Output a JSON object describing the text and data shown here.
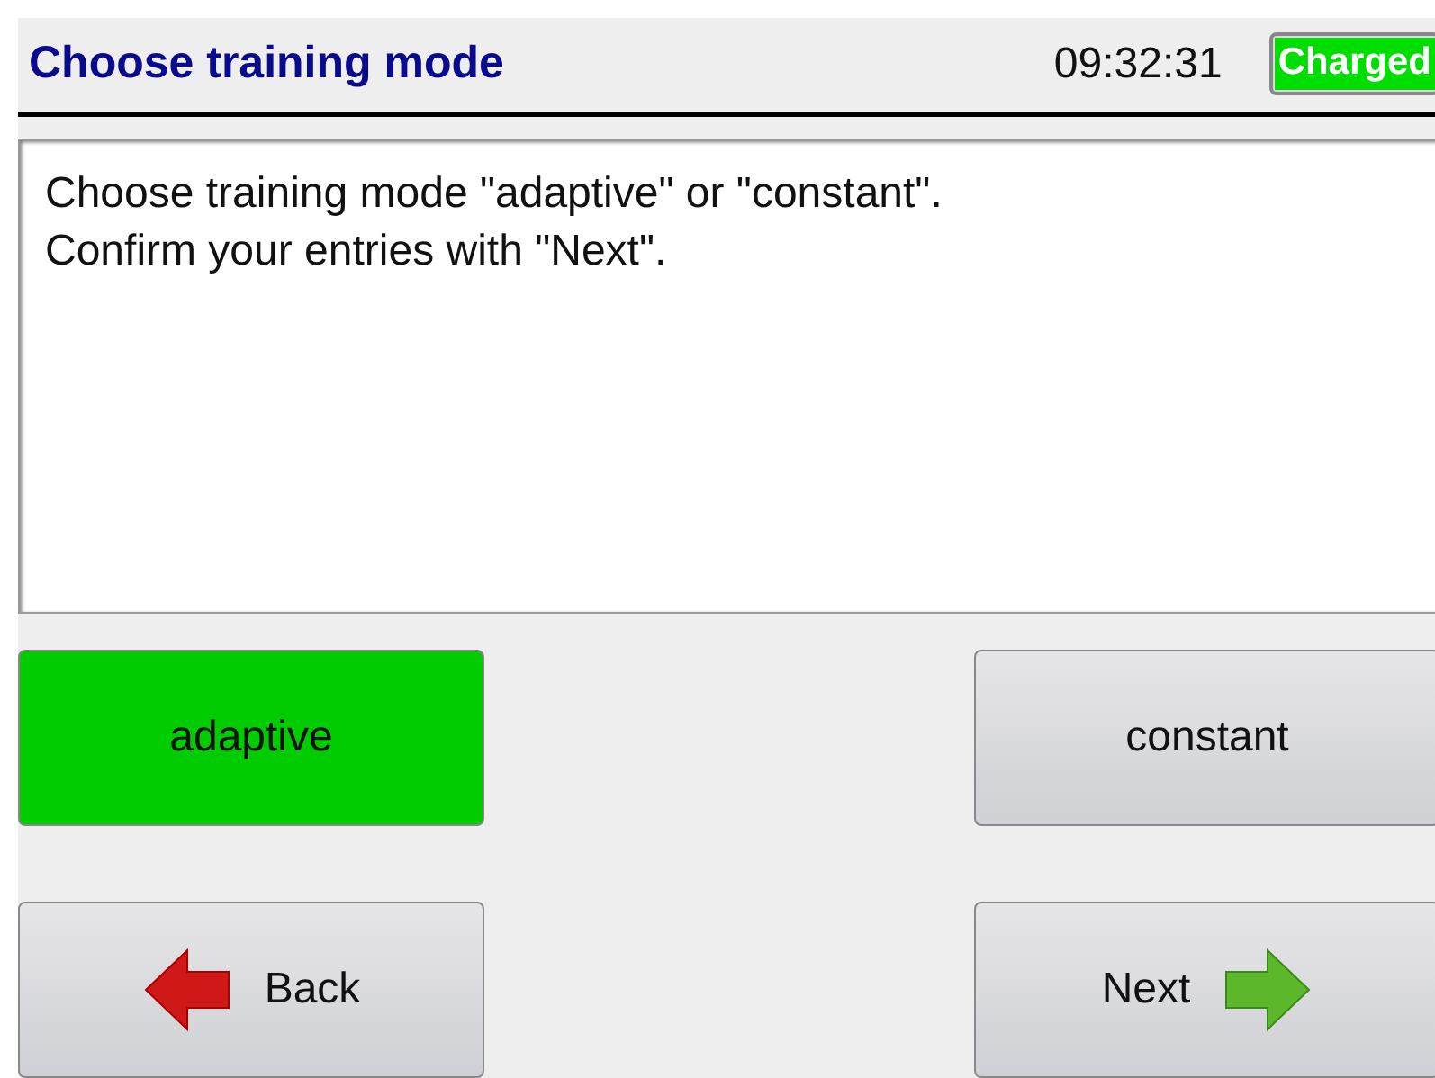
{
  "header": {
    "title": "Choose training mode",
    "time": "09:32:31",
    "battery": "Charged"
  },
  "message": [
    "Choose training mode \"adaptive\" or \"constant\".",
    "Confirm your entries with \"Next\"."
  ],
  "modes": [
    {
      "label": "adaptive",
      "selected": true
    },
    {
      "label": "constant",
      "selected": false
    }
  ],
  "nav": [
    {
      "label": "Back",
      "kind": "back"
    },
    {
      "label": "Next",
      "kind": "next"
    }
  ]
}
